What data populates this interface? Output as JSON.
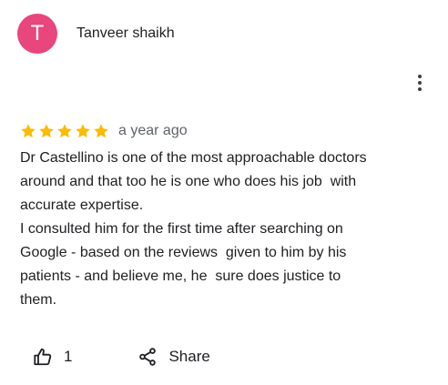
{
  "review": {
    "reviewer": {
      "initial": "T",
      "name": "Tanveer shaikh",
      "avatar_color": "#e8467c"
    },
    "rating": {
      "stars": 5,
      "max_stars": 5,
      "star_color": "#fbbc04"
    },
    "date": "a year ago",
    "text": "Dr Castellino is one of the most approachable doctors\naround and that too he is one who does his job  with\naccurate expertise.\nI consulted him for the first time after searching on\nGoogle - based on the reviews  given to him by his\npatients - and believe me, he  sure does justice to\nthem.",
    "like_count": "1",
    "share_label": "Share"
  },
  "icons": {
    "menu": "more-vert-icon",
    "like": "thumb-up-icon",
    "share": "share-icon"
  }
}
